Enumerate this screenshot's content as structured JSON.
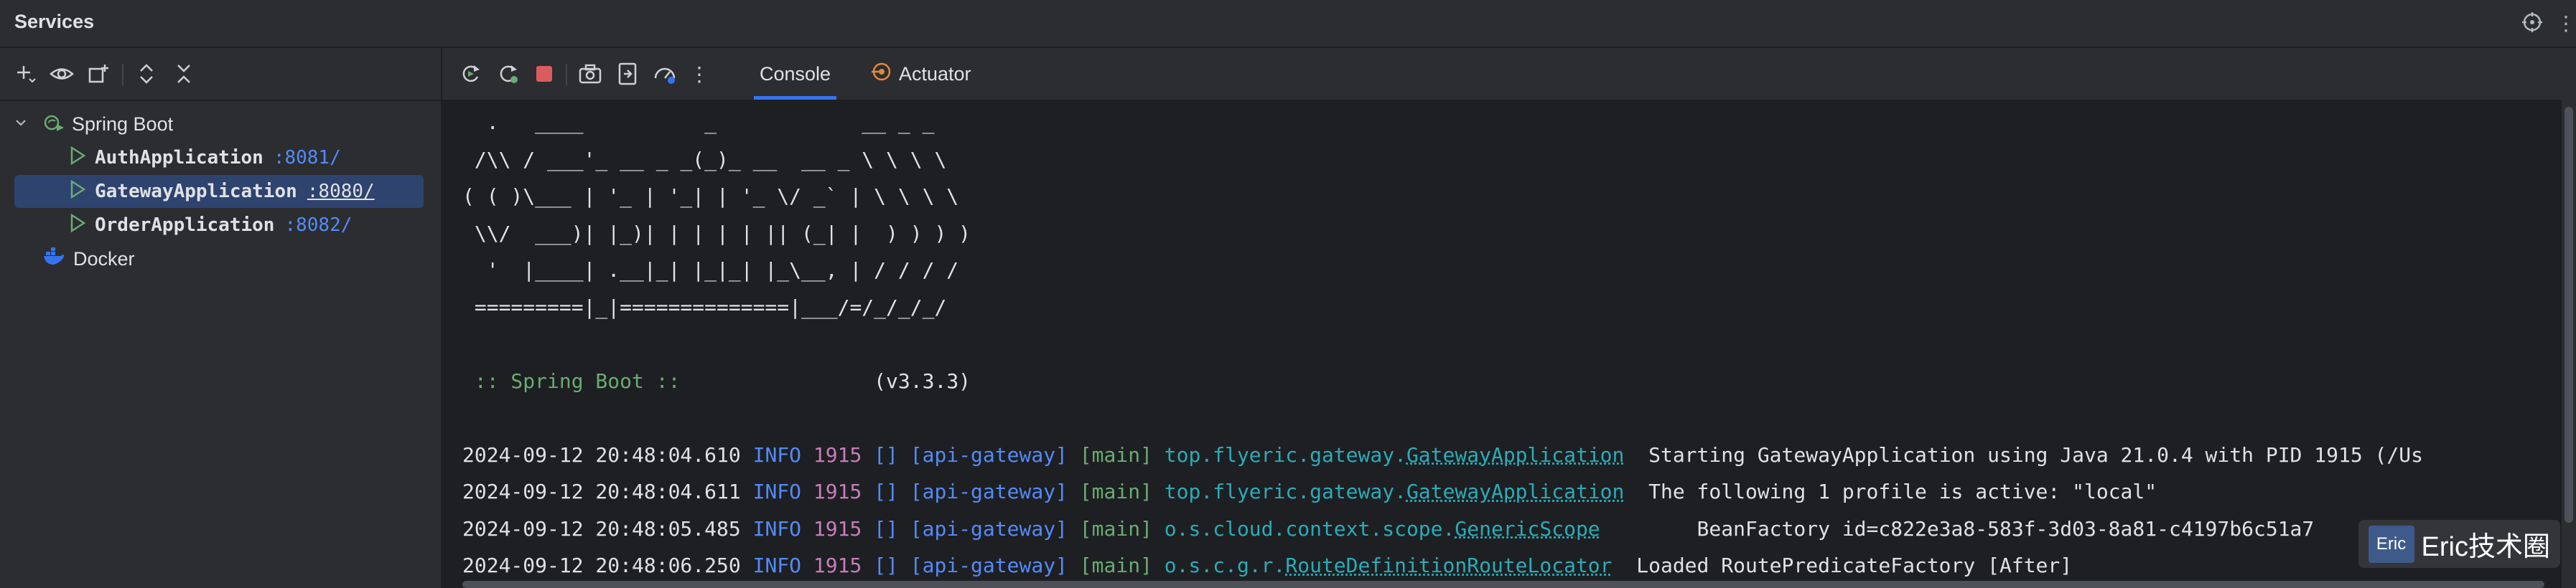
{
  "window": {
    "title": "Services"
  },
  "sidebar": {
    "tree": [
      {
        "label": "Spring Boot",
        "type": "group"
      },
      {
        "label": "AuthApplication",
        "port": ":8081/"
      },
      {
        "label": "GatewayApplication",
        "port": ":8080/",
        "selected": true
      },
      {
        "label": "OrderApplication",
        "port": ":8082/"
      },
      {
        "label": "Docker",
        "type": "group"
      }
    ]
  },
  "tabs": [
    {
      "label": "Console",
      "active": true
    },
    {
      "label": "Actuator"
    }
  ],
  "console": {
    "banner": [
      "  .   ____          _            __ _ _",
      " /\\\\ / ___'_ __ _ _(_)_ __  __ _ \\ \\ \\ \\",
      "( ( )\\___ | '_ | '_| | '_ \\/ _` | \\ \\ \\ \\",
      " \\\\/  ___)| |_)| | | | | || (_| |  ) ) ) )",
      "  '  |____| .__|_| |_|_| |_\\__, | / / / /",
      " =========|_|==============|___/=/_/_/_/"
    ],
    "spring_boot_label": " :: Spring Boot :: ",
    "version": "(v3.3.3)",
    "logs": [
      {
        "ts": "2024-09-12 20:48:04.610",
        "level": "INFO",
        "pid": "1915",
        "ctx": "[]",
        "app": "[api-gateway]",
        "thread": "[main]",
        "logger_pkg": "top.flyeric.gateway.",
        "logger_cls": "GatewayApplication",
        "msg": "Starting GatewayApplication using Java 21.0.4 with PID 1915 (/Us"
      },
      {
        "ts": "2024-09-12 20:48:04.611",
        "level": "INFO",
        "pid": "1915",
        "ctx": "[]",
        "app": "[api-gateway]",
        "thread": "[main]",
        "logger_pkg": "top.flyeric.gateway.",
        "logger_cls": "GatewayApplication",
        "msg": "The following 1 profile is active: \"local\""
      },
      {
        "ts": "2024-09-12 20:48:05.485",
        "level": "INFO",
        "pid": "1915",
        "ctx": "[]",
        "app": "[api-gateway]",
        "thread": "[main]",
        "logger_pkg": "o.s.cloud.context.scope.",
        "logger_cls": "GenericScope",
        "msg": "BeanFactory id=c822e3a8-583f-3d03-8a81-c4197b6c51a7"
      },
      {
        "ts": "2024-09-12 20:48:06.250",
        "level": "INFO",
        "pid": "1915",
        "ctx": "[]",
        "app": "[api-gateway]",
        "thread": "[main]",
        "logger_pkg": "o.s.c.g.r.",
        "logger_cls": "RouteDefinitionRouteLocator",
        "msg": "Loaded RoutePredicateFactory [After]"
      }
    ]
  },
  "watermark": {
    "logo_text": "Eric",
    "text": "Eric技术圈"
  }
}
